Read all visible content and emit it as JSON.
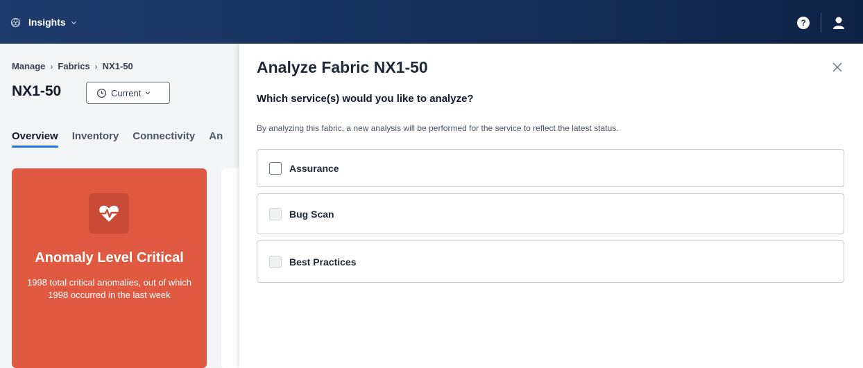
{
  "topbar": {
    "app_name": "Insights",
    "logo_icon": "insights-logo-icon",
    "help_label": "?",
    "user_icon": "user-icon",
    "colors": {
      "background": "#17305c"
    }
  },
  "left": {
    "breadcrumb": [
      "Manage",
      "Fabrics",
      "NX1-50"
    ],
    "title": "NX1-50",
    "time_selector": "Current",
    "tabs": [
      "Overview",
      "Inventory",
      "Connectivity",
      "An"
    ],
    "active_tab": "Overview",
    "anomaly_card": {
      "title": "Anomaly Level Critical",
      "description": "1998 total critical anomalies, out of which 1998 occurred in the last week",
      "color": "#e05a42",
      "icon": "heartbeat-icon"
    }
  },
  "panel": {
    "title": "Analyze Fabric NX1-50",
    "question": "Which service(s) would you like to analyze?",
    "info": "By analyzing this fabric, a new analysis will be performed for the service to reflect the latest status.",
    "options": [
      {
        "label": "Assurance",
        "enabled": true,
        "checked": false
      },
      {
        "label": "Bug Scan",
        "enabled": false,
        "checked": false
      },
      {
        "label": "Best Practices",
        "enabled": false,
        "checked": false
      }
    ]
  }
}
